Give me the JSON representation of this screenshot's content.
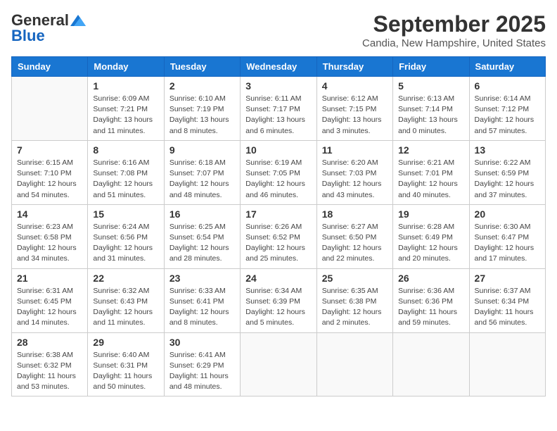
{
  "header": {
    "logo_line1": "General",
    "logo_line2": "Blue",
    "month": "September 2025",
    "location": "Candia, New Hampshire, United States"
  },
  "weekdays": [
    "Sunday",
    "Monday",
    "Tuesday",
    "Wednesday",
    "Thursday",
    "Friday",
    "Saturday"
  ],
  "weeks": [
    [
      {
        "day": "",
        "info": ""
      },
      {
        "day": "1",
        "info": "Sunrise: 6:09 AM\nSunset: 7:21 PM\nDaylight: 13 hours\nand 11 minutes."
      },
      {
        "day": "2",
        "info": "Sunrise: 6:10 AM\nSunset: 7:19 PM\nDaylight: 13 hours\nand 8 minutes."
      },
      {
        "day": "3",
        "info": "Sunrise: 6:11 AM\nSunset: 7:17 PM\nDaylight: 13 hours\nand 6 minutes."
      },
      {
        "day": "4",
        "info": "Sunrise: 6:12 AM\nSunset: 7:15 PM\nDaylight: 13 hours\nand 3 minutes."
      },
      {
        "day": "5",
        "info": "Sunrise: 6:13 AM\nSunset: 7:14 PM\nDaylight: 13 hours\nand 0 minutes."
      },
      {
        "day": "6",
        "info": "Sunrise: 6:14 AM\nSunset: 7:12 PM\nDaylight: 12 hours\nand 57 minutes."
      }
    ],
    [
      {
        "day": "7",
        "info": "Sunrise: 6:15 AM\nSunset: 7:10 PM\nDaylight: 12 hours\nand 54 minutes."
      },
      {
        "day": "8",
        "info": "Sunrise: 6:16 AM\nSunset: 7:08 PM\nDaylight: 12 hours\nand 51 minutes."
      },
      {
        "day": "9",
        "info": "Sunrise: 6:18 AM\nSunset: 7:07 PM\nDaylight: 12 hours\nand 48 minutes."
      },
      {
        "day": "10",
        "info": "Sunrise: 6:19 AM\nSunset: 7:05 PM\nDaylight: 12 hours\nand 46 minutes."
      },
      {
        "day": "11",
        "info": "Sunrise: 6:20 AM\nSunset: 7:03 PM\nDaylight: 12 hours\nand 43 minutes."
      },
      {
        "day": "12",
        "info": "Sunrise: 6:21 AM\nSunset: 7:01 PM\nDaylight: 12 hours\nand 40 minutes."
      },
      {
        "day": "13",
        "info": "Sunrise: 6:22 AM\nSunset: 6:59 PM\nDaylight: 12 hours\nand 37 minutes."
      }
    ],
    [
      {
        "day": "14",
        "info": "Sunrise: 6:23 AM\nSunset: 6:58 PM\nDaylight: 12 hours\nand 34 minutes."
      },
      {
        "day": "15",
        "info": "Sunrise: 6:24 AM\nSunset: 6:56 PM\nDaylight: 12 hours\nand 31 minutes."
      },
      {
        "day": "16",
        "info": "Sunrise: 6:25 AM\nSunset: 6:54 PM\nDaylight: 12 hours\nand 28 minutes."
      },
      {
        "day": "17",
        "info": "Sunrise: 6:26 AM\nSunset: 6:52 PM\nDaylight: 12 hours\nand 25 minutes."
      },
      {
        "day": "18",
        "info": "Sunrise: 6:27 AM\nSunset: 6:50 PM\nDaylight: 12 hours\nand 22 minutes."
      },
      {
        "day": "19",
        "info": "Sunrise: 6:28 AM\nSunset: 6:49 PM\nDaylight: 12 hours\nand 20 minutes."
      },
      {
        "day": "20",
        "info": "Sunrise: 6:30 AM\nSunset: 6:47 PM\nDaylight: 12 hours\nand 17 minutes."
      }
    ],
    [
      {
        "day": "21",
        "info": "Sunrise: 6:31 AM\nSunset: 6:45 PM\nDaylight: 12 hours\nand 14 minutes."
      },
      {
        "day": "22",
        "info": "Sunrise: 6:32 AM\nSunset: 6:43 PM\nDaylight: 12 hours\nand 11 minutes."
      },
      {
        "day": "23",
        "info": "Sunrise: 6:33 AM\nSunset: 6:41 PM\nDaylight: 12 hours\nand 8 minutes."
      },
      {
        "day": "24",
        "info": "Sunrise: 6:34 AM\nSunset: 6:39 PM\nDaylight: 12 hours\nand 5 minutes."
      },
      {
        "day": "25",
        "info": "Sunrise: 6:35 AM\nSunset: 6:38 PM\nDaylight: 12 hours\nand 2 minutes."
      },
      {
        "day": "26",
        "info": "Sunrise: 6:36 AM\nSunset: 6:36 PM\nDaylight: 11 hours\nand 59 minutes."
      },
      {
        "day": "27",
        "info": "Sunrise: 6:37 AM\nSunset: 6:34 PM\nDaylight: 11 hours\nand 56 minutes."
      }
    ],
    [
      {
        "day": "28",
        "info": "Sunrise: 6:38 AM\nSunset: 6:32 PM\nDaylight: 11 hours\nand 53 minutes."
      },
      {
        "day": "29",
        "info": "Sunrise: 6:40 AM\nSunset: 6:31 PM\nDaylight: 11 hours\nand 50 minutes."
      },
      {
        "day": "30",
        "info": "Sunrise: 6:41 AM\nSunset: 6:29 PM\nDaylight: 11 hours\nand 48 minutes."
      },
      {
        "day": "",
        "info": ""
      },
      {
        "day": "",
        "info": ""
      },
      {
        "day": "",
        "info": ""
      },
      {
        "day": "",
        "info": ""
      }
    ]
  ]
}
